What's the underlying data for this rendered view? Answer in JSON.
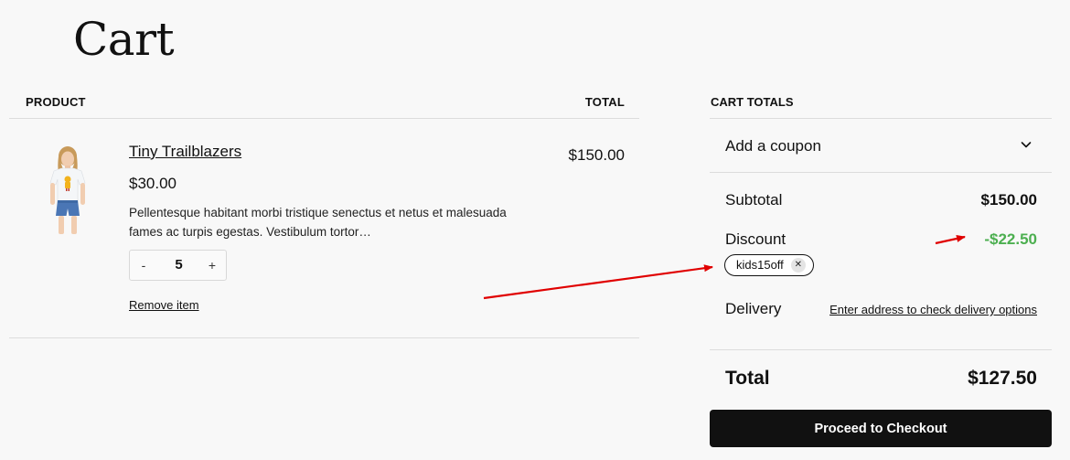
{
  "page": {
    "title": "Cart"
  },
  "cart_table": {
    "product_header": "PRODUCT",
    "total_header": "TOTAL",
    "items": [
      {
        "name": "Tiny Trailblazers",
        "price": "$30.00",
        "description": "Pellentesque habitant morbi tristique senectus et netus et malesuada fames ac turpis egestas. Vestibulum tortor…",
        "quantity": "5",
        "minus_label": "-",
        "plus_label": "+",
        "remove_label": "Remove item",
        "line_total": "$150.00",
        "image": "child-tshirt-photo"
      }
    ]
  },
  "cart_totals": {
    "header": "CART TOTALS",
    "coupon_label": "Add a coupon",
    "coupon_toggle_icon": "chevron-down-icon",
    "subtotal_label": "Subtotal",
    "subtotal_value": "$150.00",
    "discount_label": "Discount",
    "discount_value": "-$22.50",
    "coupon_code": "kids15off",
    "coupon_remove_icon": "close-icon",
    "delivery_label": "Delivery",
    "delivery_link": "Enter address to check delivery options",
    "total_label": "Total",
    "total_value": "$127.50",
    "checkout_label": "Proceed to Checkout"
  },
  "colors": {
    "background": "#f8f8f8",
    "discount": "#4caf50",
    "checkout_button": "#111111",
    "annotation_arrow": "#e00000"
  }
}
